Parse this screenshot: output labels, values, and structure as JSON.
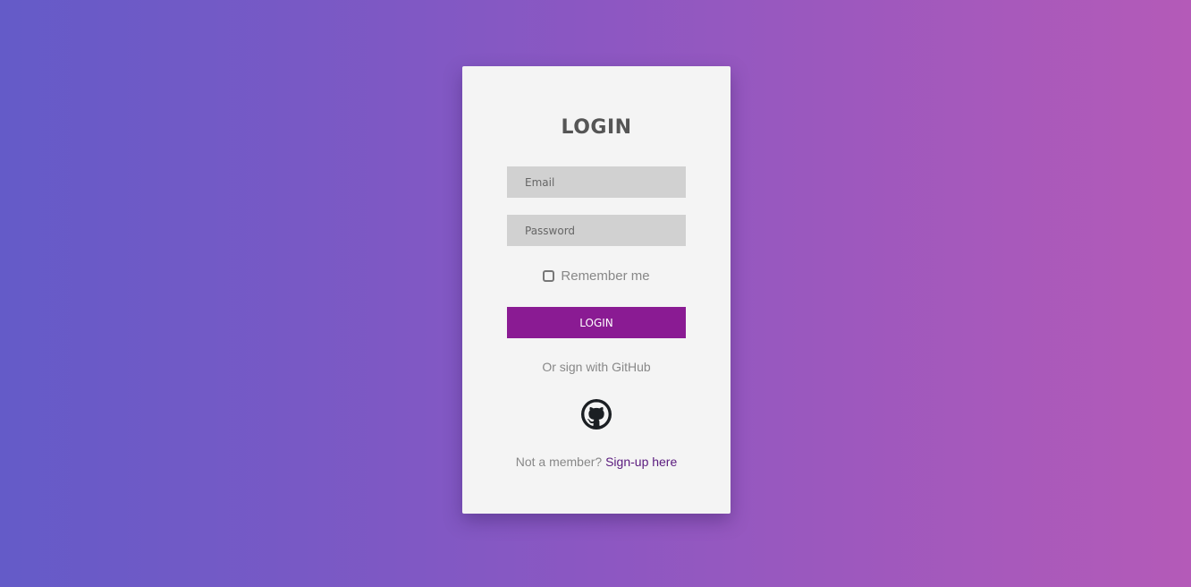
{
  "form": {
    "title": "LOGIN",
    "email_placeholder": "Email",
    "password_placeholder": "Password",
    "remember_label": "Remember me",
    "remember_checked": false,
    "login_button": "LOGIN",
    "alt_signin_text": "Or sign with GitHub",
    "github_icon": "github-icon",
    "not_member_text": "Not a member?",
    "signup_link": "Sign-up here"
  },
  "colors": {
    "background_start": "#645bc8",
    "background_end": "#b45ab8",
    "card": "#f4f4f4",
    "field": "#d1d1d1",
    "button": "#8a1b93",
    "link": "#5a1a7e"
  }
}
